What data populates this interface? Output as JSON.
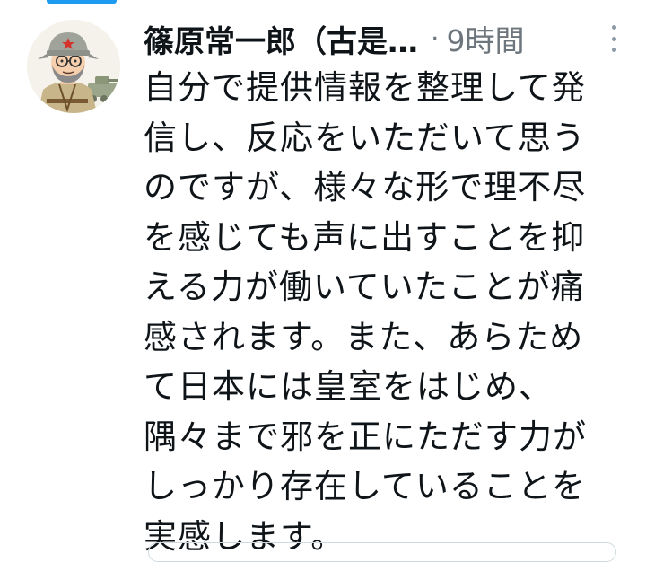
{
  "tweet": {
    "author": {
      "display_name": "篠原常一郎（古是…",
      "avatar_icon": "cartoon-soldier-avatar"
    },
    "separator": "·",
    "timestamp": "9時間",
    "text_lines": [
      "自分で提供情報を整理して発",
      "信し、反応をいただいて思う",
      "のですが、様々な形で理不尽",
      "を感じても声に出すことを抑",
      "える力が働いていたことが痛",
      "感されます。また、あらため",
      "て日本には皇室をはじめ、",
      "隅々まで邪を正にただす力が",
      "しっかり存在していることを",
      "実感します。"
    ]
  },
  "colors": {
    "accent": "#1d9bf0",
    "text": "#0f1419",
    "secondary": "#6e767d"
  }
}
